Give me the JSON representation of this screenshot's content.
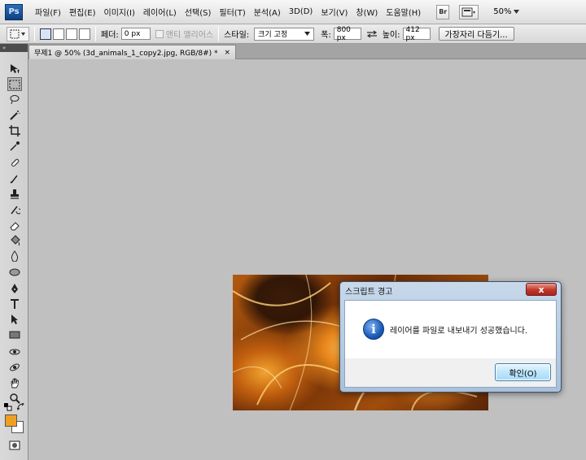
{
  "app": {
    "logo": "Ps"
  },
  "menu": {
    "items": [
      "파일(F)",
      "편집(E)",
      "이미지(I)",
      "레이어(L)",
      "선택(S)",
      "필터(T)",
      "분석(A)",
      "3D(D)",
      "보기(V)",
      "창(W)",
      "도움말(H)"
    ],
    "bridge_label": "Br",
    "zoom_value": "50%"
  },
  "options": {
    "feather_label": "페더:",
    "feather_value": "0 px",
    "antialias_label": "앤티 앨리어스",
    "style_label": "스타일:",
    "style_value": "크기 고정",
    "width_label": "폭:",
    "width_value": "800 px",
    "height_label": "높이:",
    "height_value": "412 px",
    "refine_edge_label": "가장자리 다듬기..."
  },
  "document": {
    "tab_title": "무제1 @ 50% (3d_animals_1_copy2.jpg, RGB/8#) *",
    "tab_close": "×"
  },
  "colors": {
    "foreground": "#f0a020",
    "background": "#ffffff"
  },
  "dialog": {
    "title": "스크립트 경고",
    "close_glyph": "x",
    "message": "레이어를 파일로 내보내기 성공했습니다.",
    "ok_label": "확인(O)",
    "icon": "info-icon"
  }
}
